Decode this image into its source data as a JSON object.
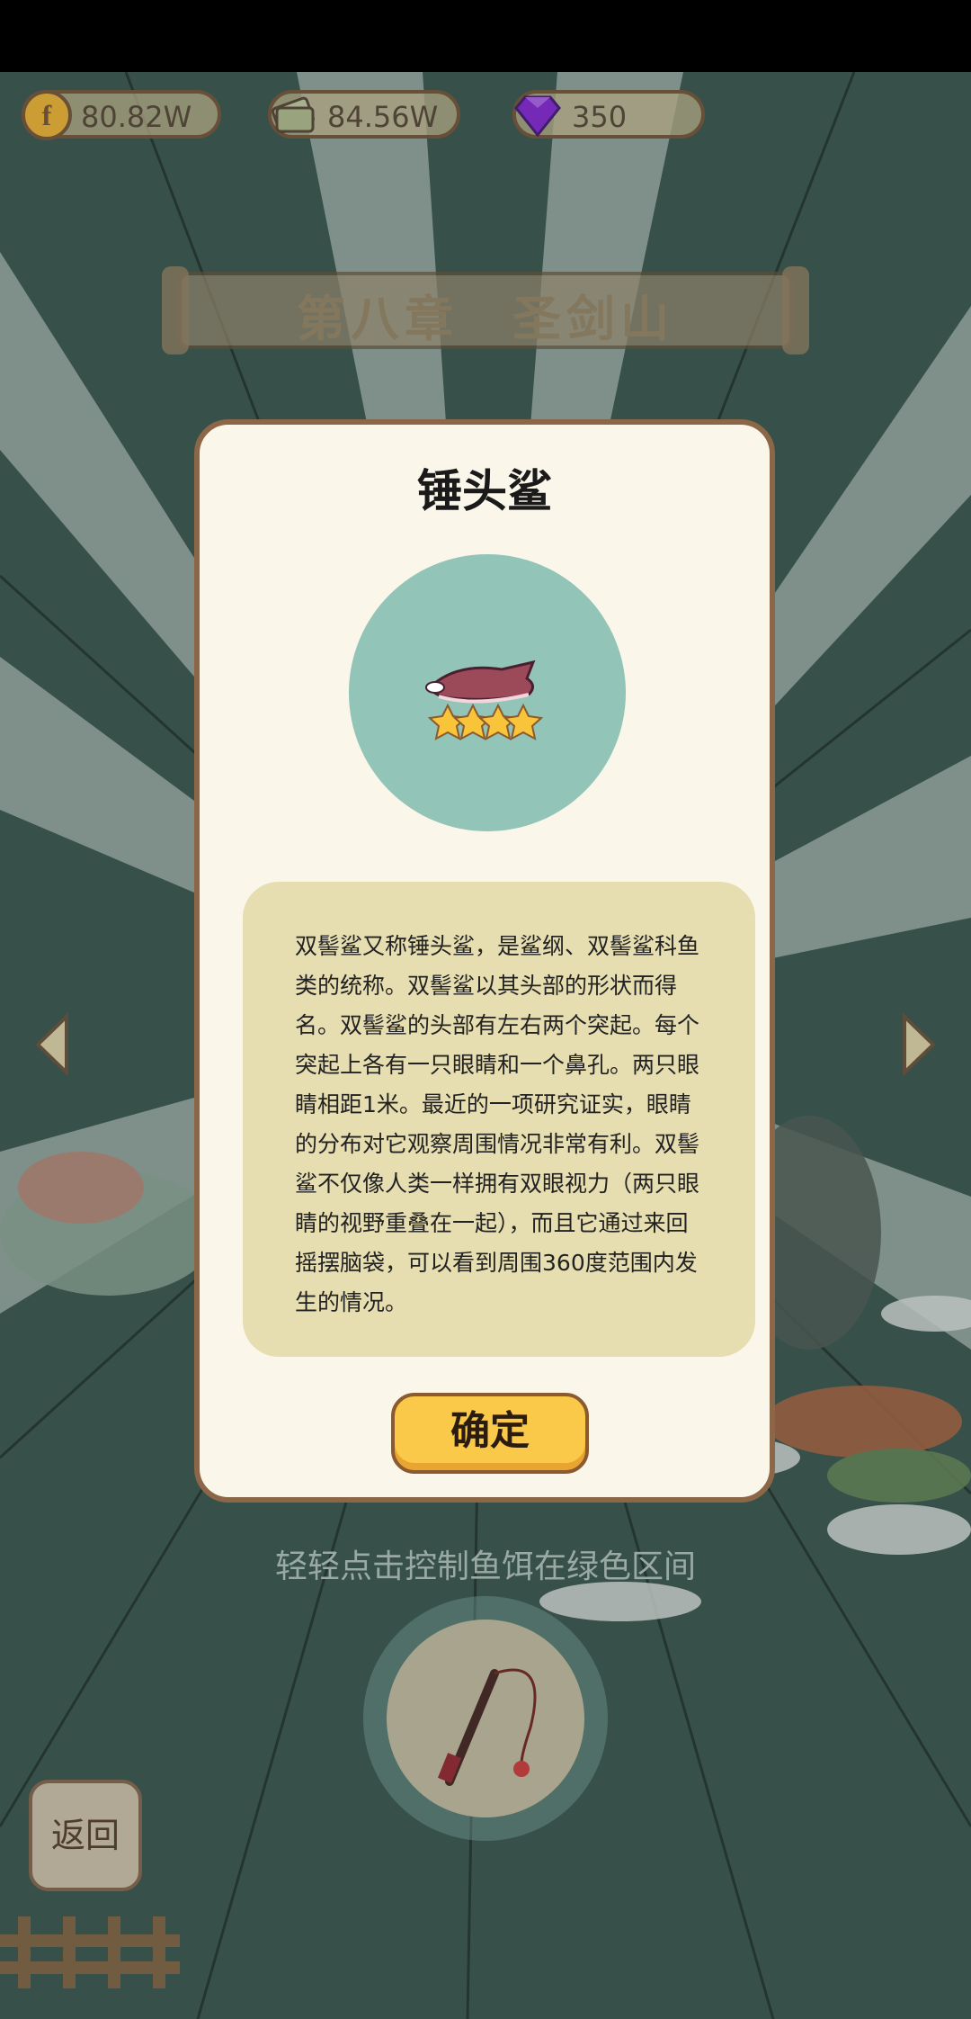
{
  "resources": {
    "coins": "80.82W",
    "cash": "84.56W",
    "gems": "350"
  },
  "chapter_title": "第八章　圣剑山",
  "dialog": {
    "fish_name": "锤头鲨",
    "stars": 4,
    "description": "双髻鲨又称锤头鲨，是鲨纲、双髻鲨科鱼类的统称。双髻鲨以其头部的形状而得名。双髻鲨的头部有左右两个突起。每个突起上各有一只眼睛和一个鼻孔。两只眼睛相距1米。最近的一项研究证实，眼睛的分布对它观察周围情况非常有利。双髻鲨不仅像人类一样拥有双眼视力（两只眼睛的视野重叠在一起），而且它通过来回摇摆脑袋，可以看到周围360度范围内发生的情况。",
    "confirm_label": "确定"
  },
  "hint": "轻轻点击控制鱼饵在绿色区间",
  "back_label": "返回",
  "colors": {
    "dialog_bg": "#fbf6ea",
    "fish_circle": "#92c4b8",
    "desc_bg": "#e6ddb0",
    "confirm_bg": "#fbc94a",
    "gem": "#8a2bd8"
  }
}
